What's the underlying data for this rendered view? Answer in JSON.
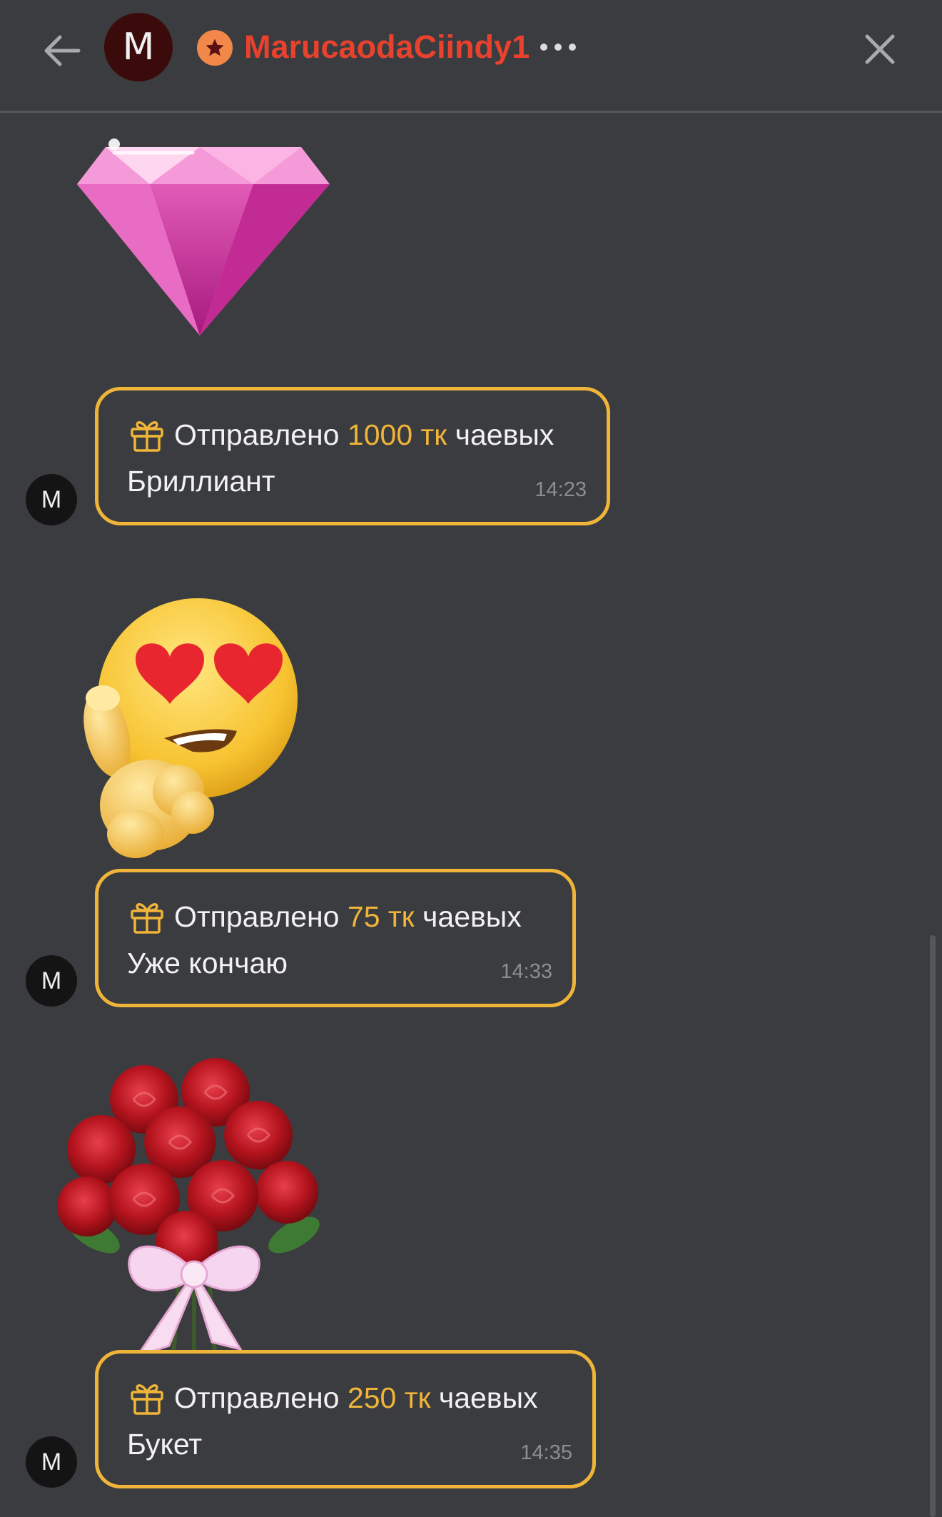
{
  "header": {
    "avatar_letter": "M",
    "username": "MarucaodaCiindy1",
    "more_label": "•••",
    "back_icon": "arrow-left-icon",
    "close_icon": "close-icon",
    "badge_icon": "star-icon"
  },
  "messages": [
    {
      "gift_image": "diamond-gift",
      "sent_prefix": "Отправлено",
      "amount": "1000 тк",
      "sent_suffix": "чаевых",
      "gift_name": "Бриллиант",
      "time": "14:23",
      "sender_letter": "M"
    },
    {
      "gift_image": "heart-eyes-emoji-gift",
      "sent_prefix": "Отправлено",
      "amount": "75 тк",
      "sent_suffix": "чаевых",
      "gift_name": "Уже кончаю",
      "time": "14:33",
      "sender_letter": "M"
    },
    {
      "gift_image": "rose-bouquet-gift",
      "sent_prefix": "Отправлено",
      "amount": "250 тк",
      "sent_suffix": "чаевых",
      "gift_name": "Букет",
      "time": "14:35",
      "sender_letter": "M"
    }
  ],
  "colors": {
    "background": "#3b3c3f",
    "accent": "#f0b538",
    "username": "#e8422e",
    "timestamp": "#8d8e92"
  }
}
